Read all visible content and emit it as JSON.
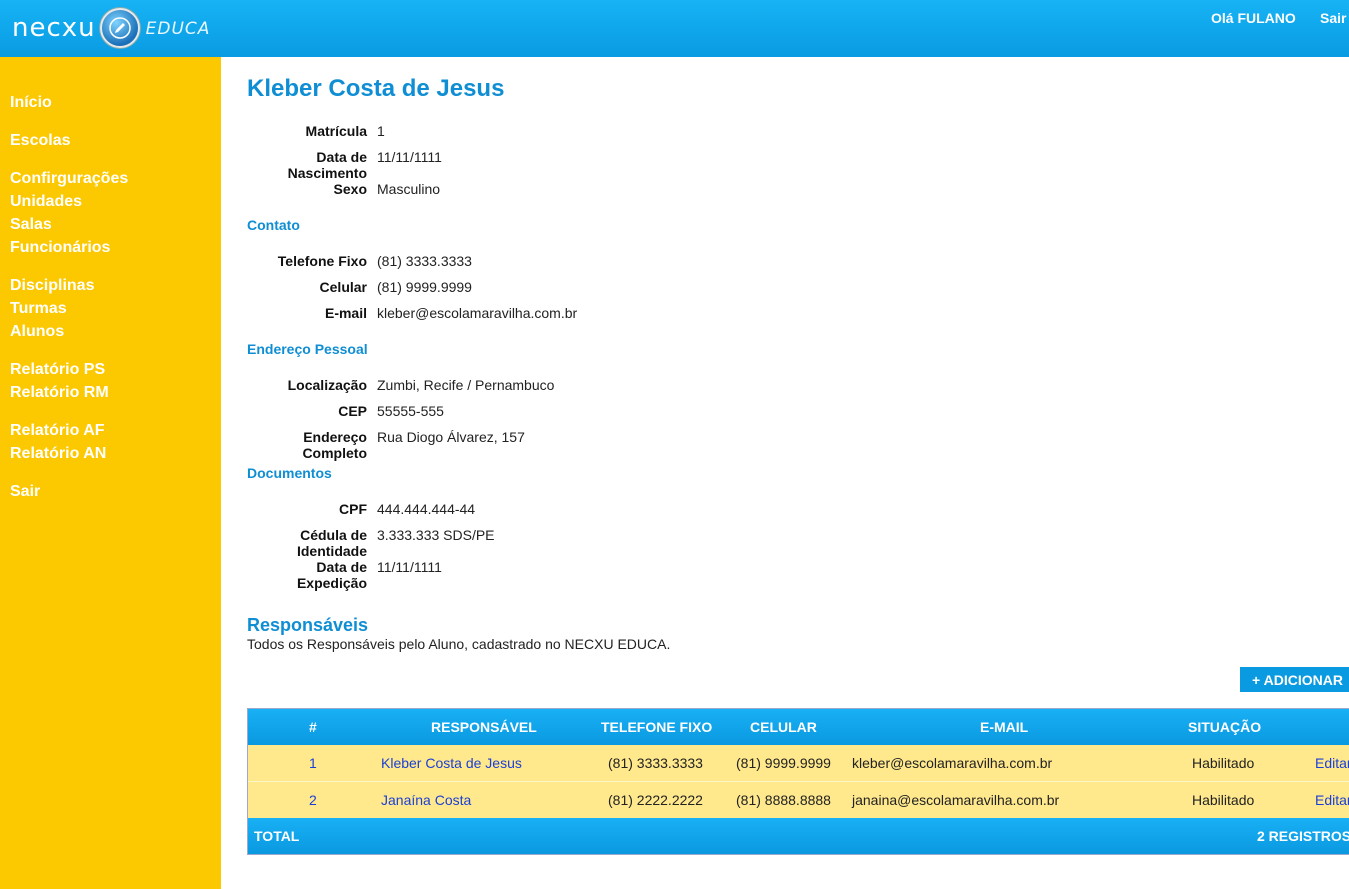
{
  "header": {
    "logo_text": "necxu",
    "logo_sub": "EDUCA",
    "greeting": "Olá FULANO",
    "logout": "Sair"
  },
  "sidebar": {
    "items": [
      {
        "label": "Início"
      },
      {
        "label": "Escolas"
      },
      {
        "label": "Confirgurações"
      },
      {
        "label": "Unidades"
      },
      {
        "label": "Salas"
      },
      {
        "label": "Funcionários"
      },
      {
        "label": "Disciplinas"
      },
      {
        "label": "Turmas"
      },
      {
        "label": "Alunos"
      },
      {
        "label": "Relatório PS"
      },
      {
        "label": "Relatório RM"
      },
      {
        "label": "Relatório AF"
      },
      {
        "label": "Relatório AN"
      },
      {
        "label": "Sair"
      }
    ]
  },
  "student": {
    "name": "Kleber Costa de Jesus",
    "basic": [
      {
        "label": "Matrícula",
        "value": "1"
      },
      {
        "label": "Data de\nNascimento",
        "value": "11/11/1111"
      },
      {
        "label": "Sexo",
        "value": "Masculino"
      }
    ],
    "contact_title": "Contato",
    "contact": [
      {
        "label": "Telefone Fixo",
        "value": "(81) 3333.3333"
      },
      {
        "label": "Celular",
        "value": "(81) 9999.9999"
      },
      {
        "label": "E-mail",
        "value": "kleber@escolamaravilha.com.br"
      }
    ],
    "address_title": "Endereço Pessoal",
    "address": [
      {
        "label": "Localização",
        "value": "Zumbi, Recife / Pernambuco"
      },
      {
        "label": "CEP",
        "value": "55555-555"
      },
      {
        "label": "Endereço\nCompleto",
        "value": "Rua Diogo Álvarez, 157"
      }
    ],
    "documents_title": "Documentos",
    "documents": [
      {
        "label": "CPF",
        "value": "444.444.444-44"
      },
      {
        "label": "Cédula de\nIdentidade",
        "value": "3.333.333 SDS/PE"
      },
      {
        "label": "Data de\nExpedição",
        "value": "11/11/1111"
      }
    ]
  },
  "responsaveis": {
    "title": "Responsáveis",
    "description": "Todos os Responsáveis pelo Aluno, cadastrado no NECXU EDUCA.",
    "add_button": "+ ADICIONAR",
    "table": {
      "headers": [
        "#",
        "RESPONSÁVEL",
        "TELEFONE FIXO",
        "CELULAR",
        "E-MAIL",
        "SITUAÇÃO"
      ],
      "rows": [
        {
          "num": "1",
          "name": "Kleber Costa de Jesus",
          "phone": "(81) 3333.3333",
          "cell": "(81) 9999.9999",
          "email": "kleber@escolamaravilha.com.br",
          "status": "Habilitado",
          "action": "Editar"
        },
        {
          "num": "2",
          "name": "Janaína Costa",
          "phone": "(81) 2222.2222",
          "cell": "(81) 8888.8888",
          "email": "janaina@escolamaravilha.com.br",
          "status": "Habilitado",
          "action": "Editar"
        }
      ],
      "footer_label": "TOTAL",
      "footer_count": "2 REGISTROS"
    }
  }
}
